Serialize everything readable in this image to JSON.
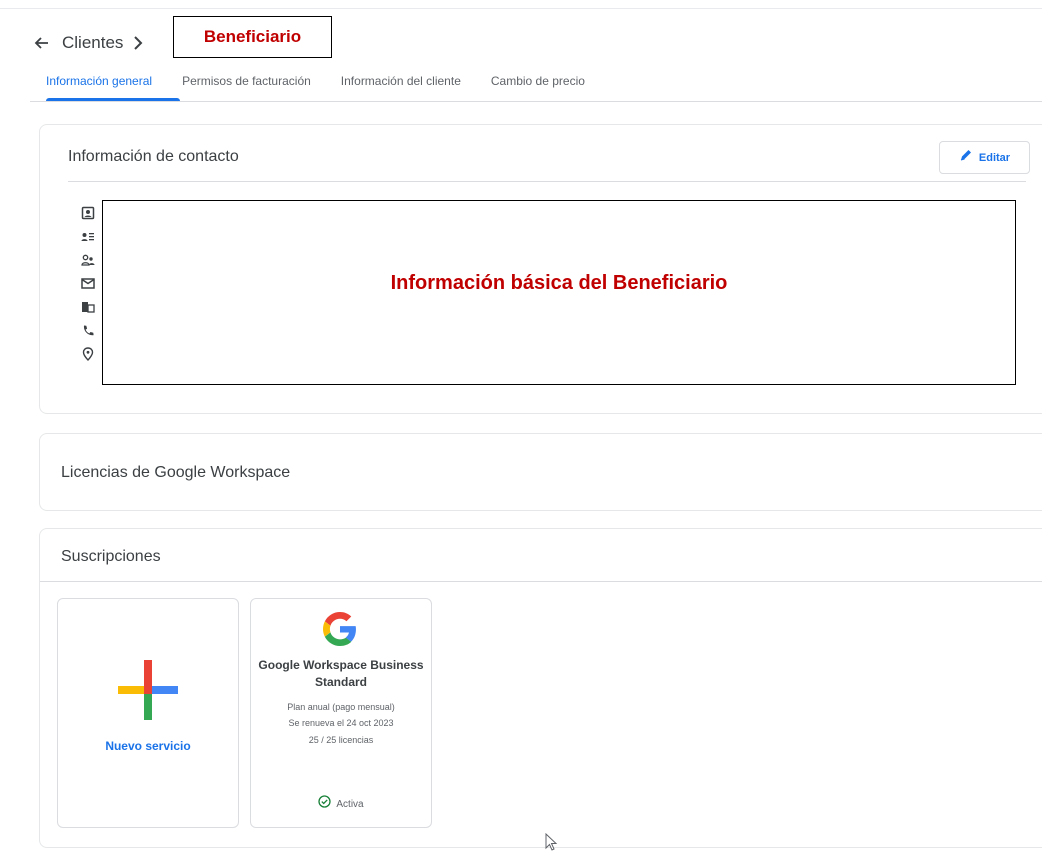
{
  "breadcrumb": {
    "parent": "Clientes",
    "current": "Beneficiario"
  },
  "tabs": [
    {
      "label": "Información general",
      "active": true
    },
    {
      "label": "Permisos de facturación",
      "active": false
    },
    {
      "label": "Información del cliente",
      "active": false
    },
    {
      "label": "Cambio de precio",
      "active": false
    }
  ],
  "contact": {
    "title": "Información de contacto",
    "edit_label": "Editar",
    "placeholder_text": "Información básica del Beneficiario",
    "icons": [
      "contact-card-icon",
      "person-list-icon",
      "people-icon",
      "mail-icon",
      "building-icon",
      "phone-icon",
      "location-pin-icon"
    ]
  },
  "licenses": {
    "title": "Licencias de Google Workspace"
  },
  "subscriptions": {
    "title": "Suscripciones",
    "new_service_label": "Nuevo servicio",
    "items": [
      {
        "name": "Google Workspace Business Standard",
        "plan": "Plan anual (pago mensual)",
        "renewal": "Se renueva el 24 oct 2023",
        "licenses": "25 / 25 licencias",
        "status": "Activa"
      }
    ]
  },
  "colors": {
    "accent": "#1a73e8",
    "annotation_red": "#c00000",
    "text": "#3c4043",
    "status_green": "#188038",
    "google_blue": "#4285f4",
    "google_red": "#ea4335",
    "google_yellow": "#fbbc05",
    "google_green": "#34a853"
  }
}
